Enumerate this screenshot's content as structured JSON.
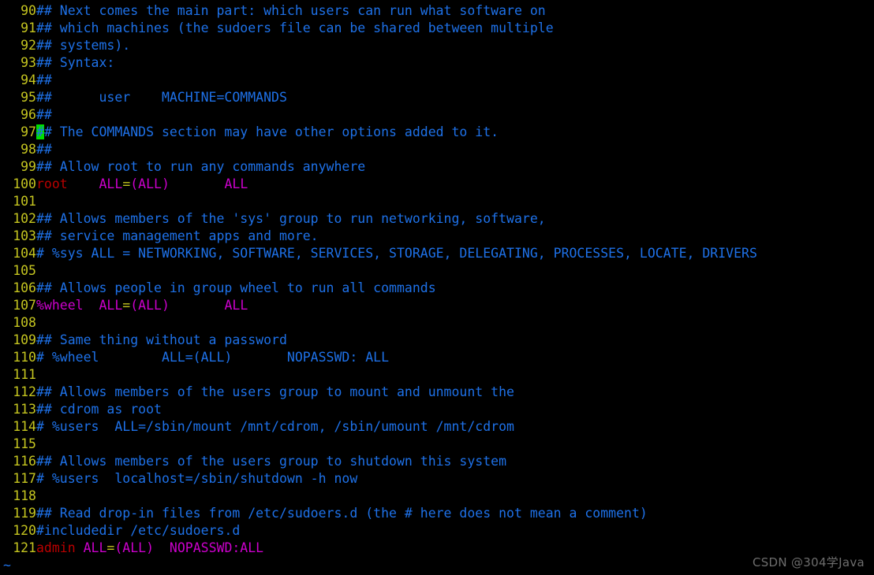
{
  "app": {
    "name": "vim",
    "file": "/etc/sudoers",
    "mode": "normal",
    "background": "#000000",
    "colors": {
      "line_number": "#c5c520",
      "comment": "#1e71e8",
      "identifier": "#bb0000",
      "special": "#cc00cc",
      "operator": "#c5c520",
      "cursor_background": "#00e000",
      "tilde": "#1e71e8",
      "watermark": "#6d6d6d"
    }
  },
  "cursor": {
    "line": 97,
    "column": 1,
    "character": "#"
  },
  "watermark": {
    "text": "CSDN @304学Java"
  },
  "filler": {
    "tilde": "~"
  },
  "buffer": {
    "first_visible_line": 90,
    "last_visible_line": 121,
    "lines": [
      {
        "num": "90",
        "segments": [
          {
            "text": "## Next comes the main part: which users can run what software on",
            "style": "comment"
          }
        ]
      },
      {
        "num": "91",
        "segments": [
          {
            "text": "## which machines (the sudoers file can be shared between multiple",
            "style": "comment"
          }
        ]
      },
      {
        "num": "92",
        "segments": [
          {
            "text": "## systems).",
            "style": "comment"
          }
        ]
      },
      {
        "num": "93",
        "segments": [
          {
            "text": "## Syntax:",
            "style": "comment"
          }
        ]
      },
      {
        "num": "94",
        "segments": [
          {
            "text": "##",
            "style": "comment"
          }
        ]
      },
      {
        "num": "95",
        "segments": [
          {
            "text": "##      user    MACHINE=COMMANDS",
            "style": "comment"
          }
        ]
      },
      {
        "num": "96",
        "segments": [
          {
            "text": "##",
            "style": "comment"
          }
        ]
      },
      {
        "num": "97",
        "segments": [
          {
            "text": "#",
            "style": "cursor"
          },
          {
            "text": "# The COMMANDS section may have other options added to it.",
            "style": "comment"
          }
        ]
      },
      {
        "num": "98",
        "segments": [
          {
            "text": "##",
            "style": "comment"
          }
        ]
      },
      {
        "num": "99",
        "segments": [
          {
            "text": "## Allow root to run any commands anywhere",
            "style": "comment"
          }
        ]
      },
      {
        "num": "100",
        "segments": [
          {
            "text": "root",
            "style": "ident"
          },
          {
            "text": "    ",
            "style": "plain"
          },
          {
            "text": "ALL",
            "style": "spec"
          },
          {
            "text": "=",
            "style": "op"
          },
          {
            "text": "(ALL)",
            "style": "spec"
          },
          {
            "text": "       ",
            "style": "plain"
          },
          {
            "text": "ALL",
            "style": "spec"
          }
        ]
      },
      {
        "num": "101",
        "segments": [
          {
            "text": "",
            "style": "plain"
          }
        ]
      },
      {
        "num": "102",
        "segments": [
          {
            "text": "## Allows members of the 'sys' group to run networking, software,",
            "style": "comment"
          }
        ]
      },
      {
        "num": "103",
        "segments": [
          {
            "text": "## service management apps and more.",
            "style": "comment"
          }
        ]
      },
      {
        "num": "104",
        "segments": [
          {
            "text": "# %sys ALL = NETWORKING, SOFTWARE, SERVICES, STORAGE, DELEGATING, PROCESSES, LOCATE, DRIVERS",
            "style": "comment"
          }
        ]
      },
      {
        "num": "105",
        "segments": [
          {
            "text": "",
            "style": "plain"
          }
        ]
      },
      {
        "num": "106",
        "segments": [
          {
            "text": "## Allows people in group wheel to run all commands",
            "style": "comment"
          }
        ]
      },
      {
        "num": "107",
        "segments": [
          {
            "text": "%wheel",
            "style": "group"
          },
          {
            "text": "  ",
            "style": "plain"
          },
          {
            "text": "ALL",
            "style": "spec"
          },
          {
            "text": "=",
            "style": "op"
          },
          {
            "text": "(ALL)",
            "style": "spec"
          },
          {
            "text": "       ",
            "style": "plain"
          },
          {
            "text": "ALL",
            "style": "spec"
          }
        ]
      },
      {
        "num": "108",
        "segments": [
          {
            "text": "",
            "style": "plain"
          }
        ]
      },
      {
        "num": "109",
        "segments": [
          {
            "text": "## Same thing without a password",
            "style": "comment"
          }
        ]
      },
      {
        "num": "110",
        "segments": [
          {
            "text": "# %wheel        ALL=(ALL)       NOPASSWD: ALL",
            "style": "comment"
          }
        ]
      },
      {
        "num": "111",
        "segments": [
          {
            "text": "",
            "style": "plain"
          }
        ]
      },
      {
        "num": "112",
        "segments": [
          {
            "text": "## Allows members of the users group to mount and unmount the",
            "style": "comment"
          }
        ]
      },
      {
        "num": "113",
        "segments": [
          {
            "text": "## cdrom as root",
            "style": "comment"
          }
        ]
      },
      {
        "num": "114",
        "segments": [
          {
            "text": "# %users  ALL=/sbin/mount /mnt/cdrom, /sbin/umount /mnt/cdrom",
            "style": "comment"
          }
        ]
      },
      {
        "num": "115",
        "segments": [
          {
            "text": "",
            "style": "plain"
          }
        ]
      },
      {
        "num": "116",
        "segments": [
          {
            "text": "## Allows members of the users group to shutdown this system",
            "style": "comment"
          }
        ]
      },
      {
        "num": "117",
        "segments": [
          {
            "text": "# %users  localhost=/sbin/shutdown -h now",
            "style": "comment"
          }
        ]
      },
      {
        "num": "118",
        "segments": [
          {
            "text": "",
            "style": "plain"
          }
        ]
      },
      {
        "num": "119",
        "segments": [
          {
            "text": "## Read drop-in files from /etc/sudoers.d (the # here does not mean a comment)",
            "style": "comment"
          }
        ]
      },
      {
        "num": "120",
        "segments": [
          {
            "text": "#includedir /etc/sudoers.d",
            "style": "comment"
          }
        ]
      },
      {
        "num": "121",
        "segments": [
          {
            "text": "admin",
            "style": "ident"
          },
          {
            "text": " ",
            "style": "plain"
          },
          {
            "text": "ALL",
            "style": "spec"
          },
          {
            "text": "=",
            "style": "op"
          },
          {
            "text": "(ALL)",
            "style": "spec"
          },
          {
            "text": "  ",
            "style": "plain"
          },
          {
            "text": "NOPASSWD:ALL",
            "style": "spec"
          }
        ]
      }
    ]
  }
}
